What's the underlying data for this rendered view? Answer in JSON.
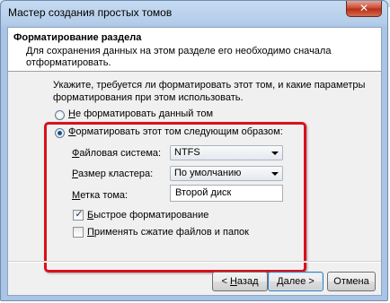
{
  "window": {
    "title": "Мастер создания простых томов",
    "close_glyph": "✕"
  },
  "header": {
    "title": "Форматирование раздела",
    "description": "Для сохранения данных на этом разделе его необходимо сначала отформатировать."
  },
  "intro": "Укажите, требуется ли форматировать этот том, и какие параметры форматирования при этом использовать.",
  "options": {
    "no_format": {
      "mnemonic": "Н",
      "rest": "е форматировать данный том",
      "selected": false
    },
    "format": {
      "mnemonic": "Ф",
      "rest": "орматировать этот том следующим образом:",
      "selected": true
    }
  },
  "fields": {
    "filesystem": {
      "mnemonic": "Ф",
      "rest": "айловая система:",
      "value": "NTFS"
    },
    "cluster": {
      "mnemonic": "Р",
      "rest": "азмер кластера:",
      "value": "По умолчанию"
    },
    "volume_label": {
      "mnemonic": "М",
      "rest": "етка тома:",
      "value": "Второй диск"
    }
  },
  "checkboxes": {
    "quick_format": {
      "mnemonic": "Б",
      "rest": "ыстрое форматирование",
      "checked": true,
      "mark": "✓"
    },
    "compression": {
      "mnemonic": "П",
      "rest": "рименять сжатие файлов и папок",
      "checked": false
    }
  },
  "buttons": {
    "back": {
      "prefix": "< ",
      "mnemonic": "Н",
      "rest": "азад"
    },
    "next": {
      "mnemonic": "Д",
      "rest": "алее >"
    },
    "cancel": {
      "label": "Отмена"
    }
  },
  "colors": {
    "highlight_border": "#d8111b",
    "title_bar": "#b4cde9"
  }
}
